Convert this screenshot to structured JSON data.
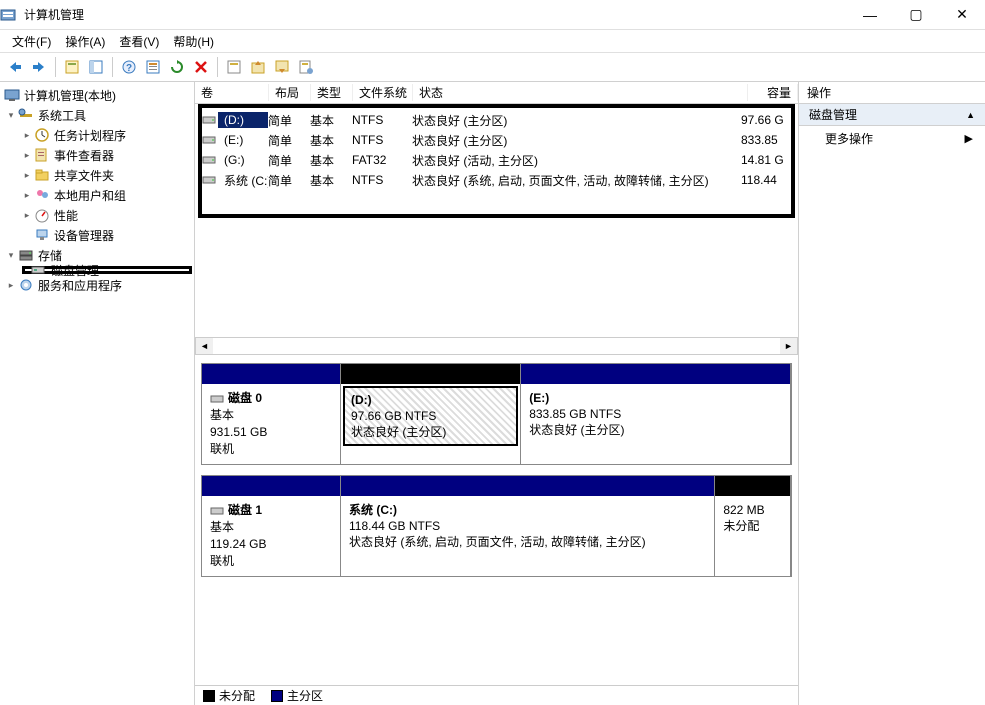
{
  "window": {
    "title": "计算机管理"
  },
  "menu": {
    "file": "文件(F)",
    "action": "操作(A)",
    "view": "查看(V)",
    "help": "帮助(H)"
  },
  "tree": {
    "root": "计算机管理(本地)",
    "systools": "系统工具",
    "tasksched": "任务计划程序",
    "eventvwr": "事件查看器",
    "shared": "共享文件夹",
    "users": "本地用户和组",
    "perf": "性能",
    "devmgr": "设备管理器",
    "storage": "存储",
    "diskmgmt": "磁盘管理",
    "services": "服务和应用程序"
  },
  "columns": {
    "vol": "卷",
    "layout": "布局",
    "type": "类型",
    "fs": "文件系统",
    "status": "状态",
    "capacity": "容量"
  },
  "volumes": [
    {
      "label": "(D:)",
      "layout": "简单",
      "type": "基本",
      "fs": "NTFS",
      "status": "状态良好 (主分区)",
      "capacity": "97.66 G",
      "selected": true
    },
    {
      "label": "(E:)",
      "layout": "简单",
      "type": "基本",
      "fs": "NTFS",
      "status": "状态良好 (主分区)",
      "capacity": "833.85"
    },
    {
      "label": "(G:)",
      "layout": "简单",
      "type": "基本",
      "fs": "FAT32",
      "status": "状态良好 (活动, 主分区)",
      "capacity": "14.81 G"
    },
    {
      "label": "系统 (C:)",
      "layout": "简单",
      "type": "基本",
      "fs": "NTFS",
      "status": "状态良好 (系统, 启动, 页面文件, 活动, 故障转储, 主分区)",
      "capacity": "118.44"
    }
  ],
  "disks": [
    {
      "name": "磁盘 0",
      "type": "基本",
      "size": "931.51 GB",
      "status": "联机",
      "parts": [
        {
          "name": "(D:)",
          "size": "97.66 GB NTFS",
          "status": "状态良好 (主分区)",
          "flex": 2,
          "selected": true
        },
        {
          "name": "(E:)",
          "size": "833.85 GB NTFS",
          "status": "状态良好 (主分区)",
          "flex": 3
        }
      ]
    },
    {
      "name": "磁盘 1",
      "type": "基本",
      "size": "119.24 GB",
      "status": "联机",
      "parts": [
        {
          "name": "系统  (C:)",
          "size": "118.44 GB NTFS",
          "status": "状态良好 (系统, 启动, 页面文件, 活动, 故障转储, 主分区)",
          "flex": 5
        },
        {
          "name": "",
          "size": "822 MB",
          "status": "未分配",
          "flex": 1,
          "unalloc": true
        }
      ]
    }
  ],
  "legend": {
    "unalloc": "未分配",
    "primary": "主分区"
  },
  "actions": {
    "header": "操作",
    "section": "磁盘管理",
    "more": "更多操作"
  }
}
